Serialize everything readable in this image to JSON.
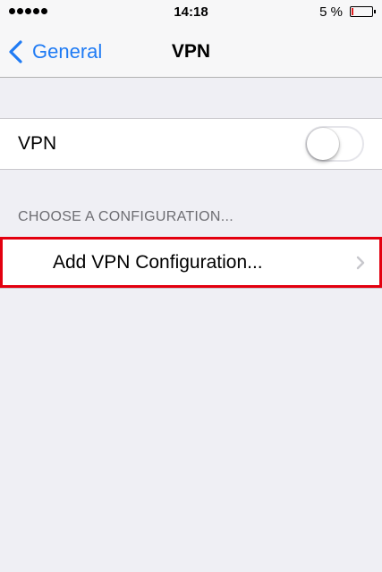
{
  "status_bar": {
    "time": "14:18",
    "battery_percent": "5 %",
    "battery_level": 0.05,
    "signal_bars": 5
  },
  "nav": {
    "back_label": "General",
    "title": "VPN"
  },
  "vpn_toggle": {
    "label": "VPN",
    "state": "off"
  },
  "section": {
    "header": "CHOOSE A CONFIGURATION..."
  },
  "add_config": {
    "label": "Add VPN Configuration...",
    "highlight_color": "#e3000f"
  },
  "colors": {
    "accent": "#1f7bf4",
    "background": "#efeff4",
    "battery_low": "#e02020"
  },
  "icons": {
    "back": "chevron-left-icon",
    "disclosure": "chevron-right-icon",
    "battery": "battery-icon",
    "signal": "signal-dots-icon"
  }
}
